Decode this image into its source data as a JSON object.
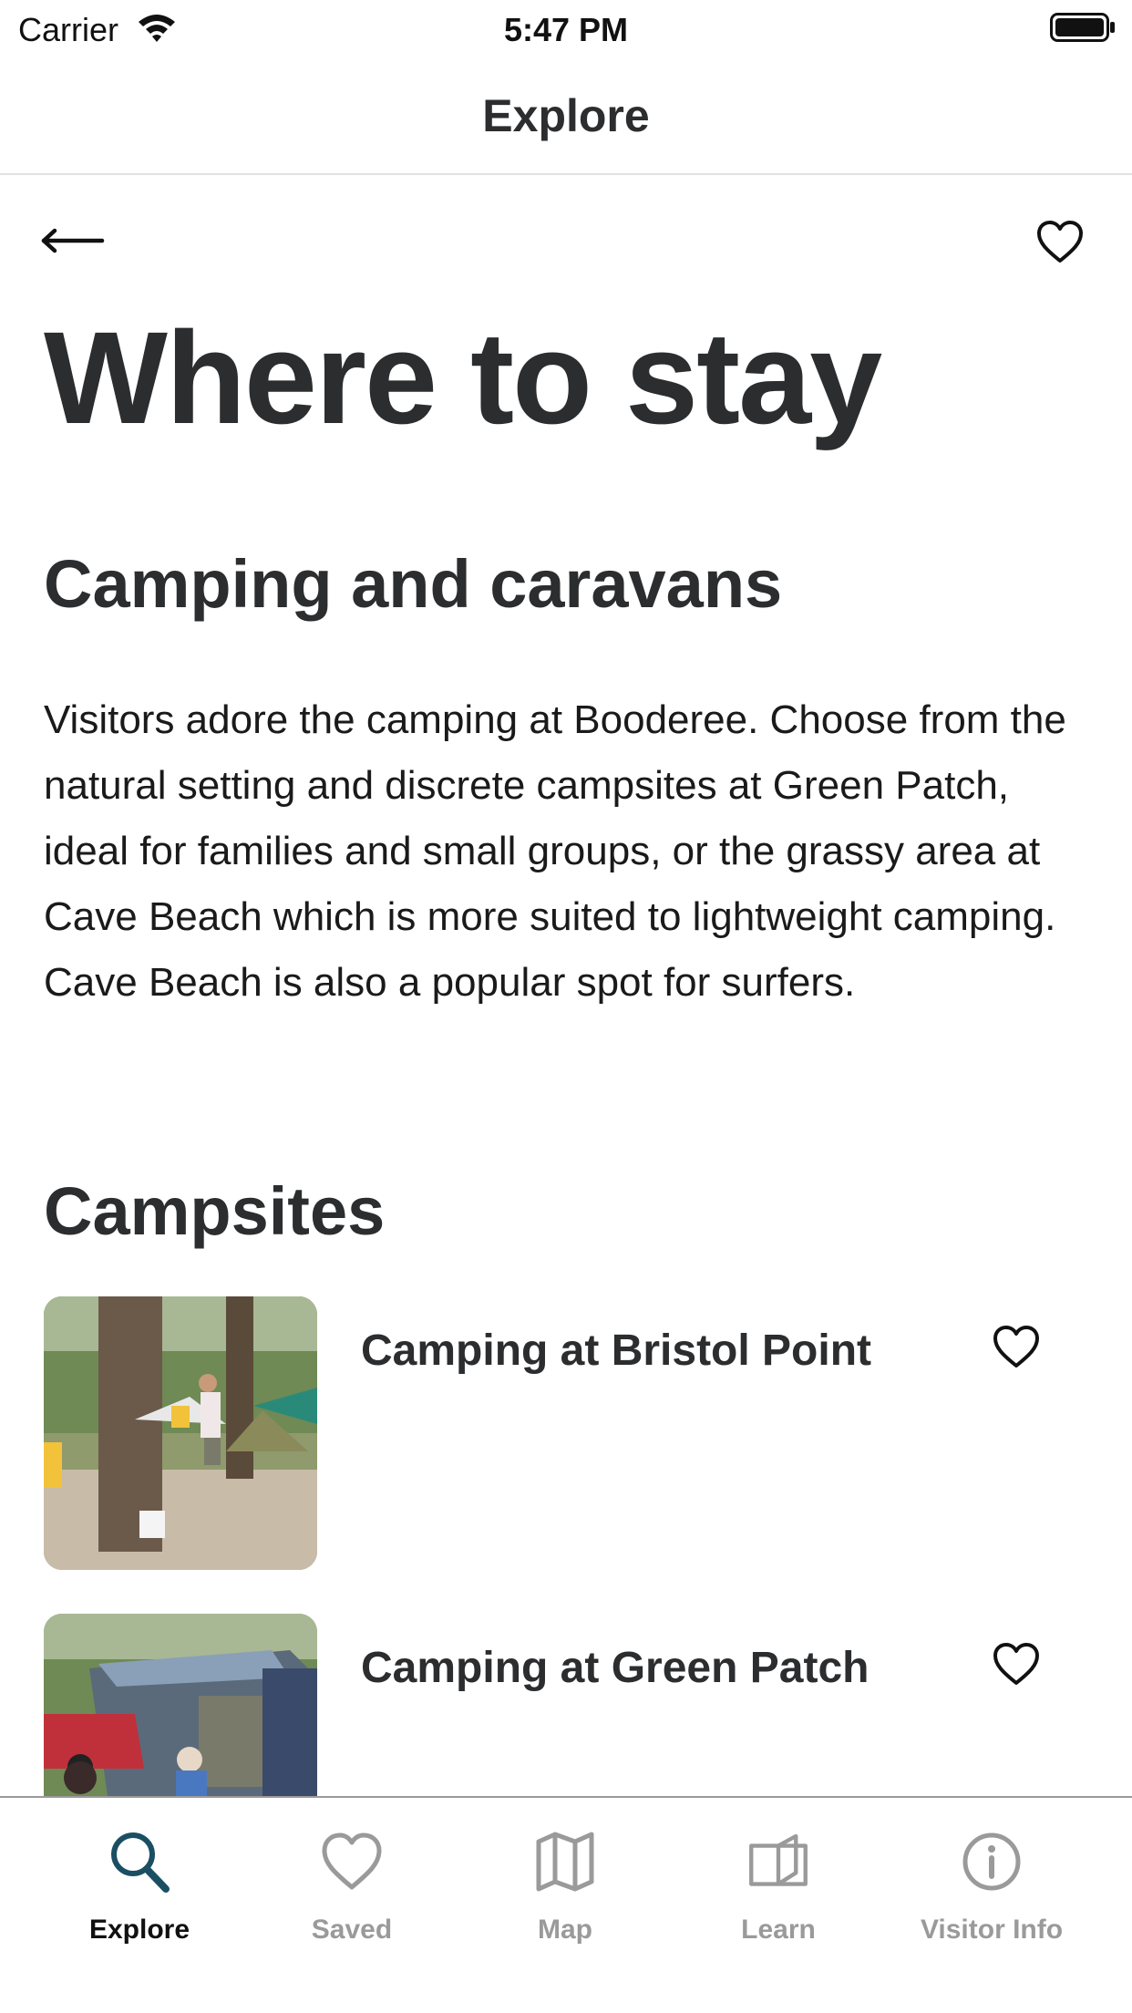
{
  "status_bar": {
    "carrier": "Carrier",
    "time": "5:47 PM"
  },
  "nav": {
    "title": "Explore"
  },
  "page": {
    "title": "Where to stay",
    "section_title": "Camping and caravans",
    "body": "Visitors adore the camping at Booderee. Choose from the natural setting and discrete campsites at Green Patch, ideal for families and small groups, or the grassy area at Cave Beach which is more suited to lightweight camping. Cave Beach is also a popular spot for surfers.",
    "list_title": "Campsites"
  },
  "campsites": [
    {
      "title": "Camping at Bristol Point"
    },
    {
      "title": "Camping at Green Patch"
    }
  ],
  "tabs": [
    {
      "label": "Explore",
      "icon": "search-icon",
      "active": true
    },
    {
      "label": "Saved",
      "icon": "heart-icon",
      "active": false
    },
    {
      "label": "Map",
      "icon": "map-icon",
      "active": false
    },
    {
      "label": "Learn",
      "icon": "book-icon",
      "active": false
    },
    {
      "label": "Visitor Info",
      "icon": "info-icon",
      "active": false
    }
  ],
  "colors": {
    "accent": "#1a4f63",
    "inactive_tab": "#9a9a9a",
    "text": "#2b2d2f"
  }
}
